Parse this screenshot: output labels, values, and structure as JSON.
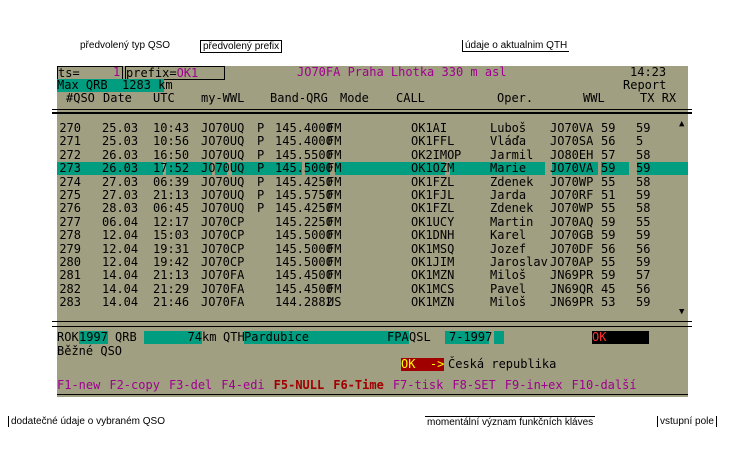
{
  "annotations": {
    "default_type": "předvolený typ QSO",
    "default_prefix": "předvolený prefix",
    "qth_info": "údaje o aktualnim QTH",
    "extra_info": "dodatečné údaje o vybraném QSO",
    "fkeys_meaning": "momentální význam funkčních kláves",
    "input_field": "vstupní pole"
  },
  "header": {
    "ts_label": "ts=",
    "ts_value": "1",
    "prefix_label": "prefix=",
    "prefix_value": "OK1",
    "qth": "JO70FA Praha Lhotka 330 m asl",
    "time": "14:23",
    "maxqrb_label": "Max QRB",
    "maxqrb_value": "1283 km",
    "report": "Report"
  },
  "columns": {
    "qso": "#QSO",
    "date": "Date",
    "utc": "UTC",
    "mywwl": "my-WWL",
    "band": "Band-QRG",
    "mode": "Mode",
    "call": "CALL",
    "oper": "Oper.",
    "wwl": "WWL",
    "tx": "TX",
    "rx": "RX"
  },
  "rows": [
    [
      "270",
      "25.03",
      "10:43",
      "JO70UQ",
      "P",
      "145.4000",
      "FM",
      "OK1AI",
      "",
      "Luboš",
      "JO70VA",
      "59",
      "59"
    ],
    [
      "271",
      "25.03",
      "10:56",
      "JO70UQ",
      "P",
      "145.4000",
      "FM",
      "OK1FFL",
      "",
      "Vláďa",
      "JO70SA",
      "56",
      "5"
    ],
    [
      "272",
      "26.03",
      "16:50",
      "JO70UQ",
      "P",
      "145.5500",
      "FM",
      "OK2IMO",
      "P",
      "Jarmil",
      "JO80EH",
      "57",
      "58"
    ],
    [
      "273",
      "26.03",
      "17:52",
      "JO70UQ",
      "P",
      "145.5000",
      "FM",
      "OK1OZM",
      "",
      "Marie",
      "JO70VA",
      "59",
      "59"
    ],
    [
      "274",
      "27.03",
      "06:39",
      "JO70UQ",
      "P",
      "145.4250",
      "FM",
      "OK1FZL",
      "",
      "Zdenek",
      "JO70WP",
      "55",
      "58"
    ],
    [
      "275",
      "27.03",
      "21:13",
      "JO70UQ",
      "P",
      "145.5750",
      "FM",
      "OK1FJL",
      "",
      "Jarda",
      "JO70RF",
      "51",
      "59"
    ],
    [
      "276",
      "28.03",
      "06:45",
      "JO70UQ",
      "P",
      "145.4250",
      "FM",
      "OK1FZL",
      "",
      "Zdenek",
      "JO70WP",
      "55",
      "58"
    ],
    [
      "277",
      "06.04",
      "12:17",
      "JO70CP",
      "",
      "145.2250",
      "FM",
      "OK1UCY",
      "",
      "Martin",
      "JO70AQ",
      "59",
      "55"
    ],
    [
      "278",
      "12.04",
      "15:03",
      "JO70CP",
      "",
      "145.5000",
      "FM",
      "OK1DNH",
      "",
      "Karel",
      "JO70GB",
      "59",
      "59"
    ],
    [
      "279",
      "12.04",
      "19:31",
      "JO70CP",
      "",
      "145.5000",
      "FM",
      "OK1MSQ",
      "",
      "Jozef",
      "JO70DF",
      "56",
      "56"
    ],
    [
      "280",
      "12.04",
      "19:42",
      "JO70CP",
      "",
      "145.5000",
      "FM",
      "OK1JIM",
      "",
      "Jaroslav",
      "JO70AP",
      "55",
      "59"
    ],
    [
      "281",
      "14.04",
      "21:13",
      "JO70FA",
      "",
      "145.4500",
      "FM",
      "OK1MZN",
      "",
      "Miloš",
      "JN69PR",
      "59",
      "57"
    ],
    [
      "282",
      "14.04",
      "21:29",
      "JO70FA",
      "",
      "145.4500",
      "FM",
      "OK1MCS",
      "",
      "Pavel",
      "JN69QR",
      "45",
      "56"
    ],
    [
      "283",
      "14.04",
      "21:46",
      "JO70FA",
      "",
      "144.2882",
      "US",
      "OK1MZN",
      "",
      "Miloš",
      "JN69PR",
      "53",
      "59"
    ]
  ],
  "selected_row": 3,
  "detail": {
    "rok_label": "ROK",
    "rok": "1997",
    "qrb_label": "QRB",
    "qrb": "74",
    "km": "km",
    "qth_label": "QTH",
    "qth": "Pardubice",
    "fpa": "FPA",
    "qsl_label": "QSL",
    "qsl": "7-1997",
    "input": "OK",
    "type": "Běžné QSO",
    "prefix_badge": "OK  ->",
    "country": "Česká republika"
  },
  "fkeys": [
    "F1-new",
    "F2-copy",
    "F3-del",
    "F4-edi",
    "F5-NULL",
    "F6-Time",
    "F7-tisk",
    "F8-SET",
    "F9-in+ex",
    "F10-další"
  ],
  "colors": {
    "bg": "#a19f82",
    "teal": "#009d80",
    "magenta": "#a0008f"
  }
}
